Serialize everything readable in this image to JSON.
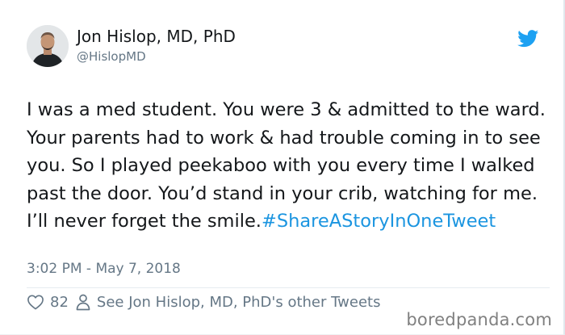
{
  "author": {
    "name": "Jon Hislop, MD, PhD",
    "handle": "@HislopMD",
    "avatar_icon": "person-avatar"
  },
  "brand": {
    "icon": "twitter-bird-icon",
    "color": "#1da1f2"
  },
  "tweet": {
    "text": "I was a med student. You were 3 & admitted to the ward. Your parents had to work & had trouble coming in to see you. So I played peekaboo with you every time I walked past the door. You’d stand in your crib, watching for me. I’ll never forget the smile.",
    "hashtag": "#ShareAStoryInOneTweet",
    "hashtag_color": "#1b95e0",
    "timestamp": "3:02 PM - May 7, 2018"
  },
  "actions": {
    "like_icon": "heart-icon",
    "like_count": "82",
    "profile_icon": "user-icon",
    "profile_link": "See Jon Hislop, MD, PhD's other Tweets"
  },
  "watermark": {
    "text": "boredpanda.com"
  }
}
